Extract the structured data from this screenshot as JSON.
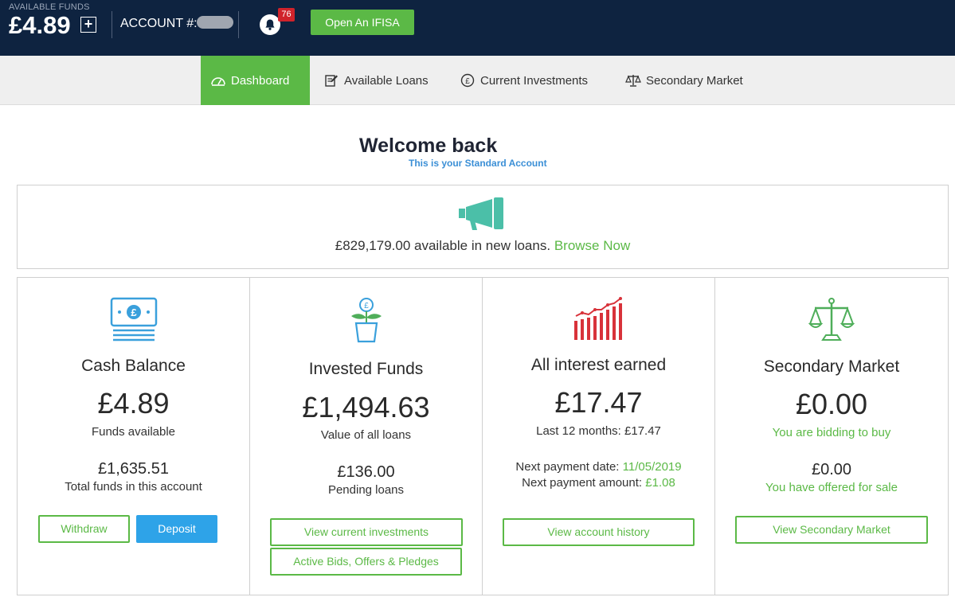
{
  "topbar": {
    "available_funds_label": "AVAILABLE FUNDS",
    "available_funds_value": "£4.89",
    "add_funds_symbol": "+",
    "account_label": "ACCOUNT #:",
    "notification_count": "76",
    "ifisa_button": "Open An IFISA"
  },
  "nav": {
    "items": [
      {
        "label": "Dashboard",
        "icon": "speedometer-icon",
        "active": true
      },
      {
        "label": "Available Loans",
        "icon": "edit-note-icon"
      },
      {
        "label": "Current Investments",
        "icon": "pound-coin-icon"
      },
      {
        "label": "Secondary Market",
        "icon": "scales-icon"
      }
    ]
  },
  "welcome": {
    "title": "Welcome back",
    "subtitle": "This is your Standard Account"
  },
  "banner": {
    "text": "£829,179.00 available in new loans.",
    "link": "Browse Now"
  },
  "cards": {
    "cash": {
      "title": "Cash Balance",
      "amount": "£4.89",
      "amount_caption": "Funds available",
      "secondary": "£1,635.51",
      "secondary_caption": "Total funds in this account",
      "withdraw": "Withdraw",
      "deposit": "Deposit"
    },
    "invested": {
      "title": "Invested Funds",
      "amount": "£1,494.63",
      "amount_caption": "Value of all loans",
      "secondary": "£136.00",
      "secondary_caption": "Pending loans",
      "button1": "View current investments",
      "button2": "Active Bids, Offers & Pledges"
    },
    "interest": {
      "title": "All interest earned",
      "amount": "£17.47",
      "last12": "Last 12 months: £17.47",
      "next_date_label": "Next payment date:",
      "next_date_value": "11/05/2019",
      "next_amount_label": "Next payment amount:",
      "next_amount_value": "£1.08",
      "button": "View account history"
    },
    "secondary": {
      "title": "Secondary Market",
      "amount": "£0.00",
      "amount_caption": "You are bidding to buy",
      "secondary": "£0.00",
      "secondary_caption": "You have offered for sale",
      "button": "View Secondary Market"
    }
  },
  "colors": {
    "topbar_bg": "#0e2340",
    "accent_green": "#5bb946",
    "deposit_blue": "#2ea3e8",
    "badge_red": "#d0232b",
    "icon_teal": "#4bbfa8",
    "icon_blue": "#3aa0dc",
    "icon_red": "#d8323a"
  }
}
